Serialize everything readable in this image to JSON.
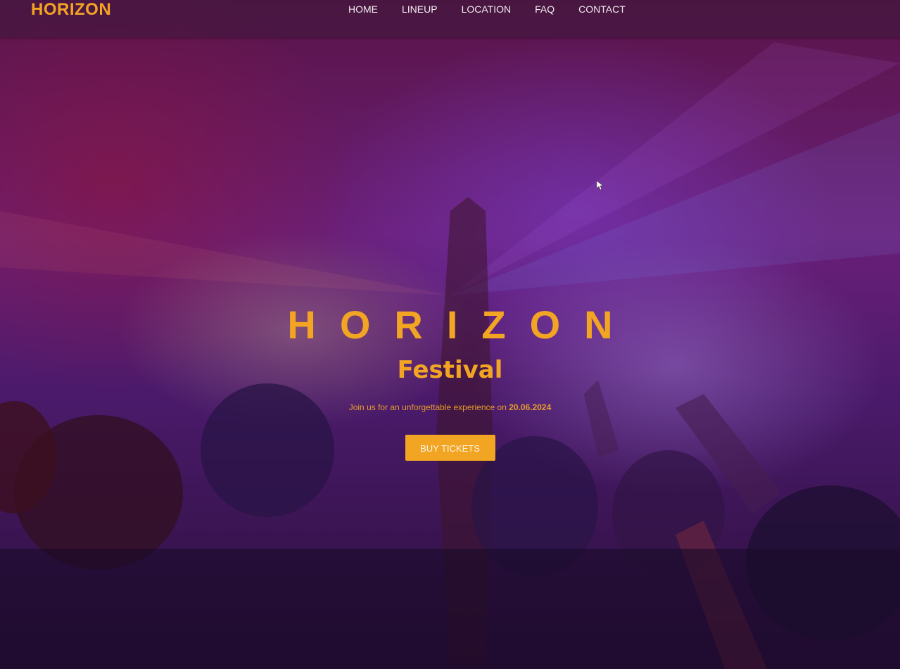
{
  "navbar": {
    "brand": "HORIZON",
    "links": [
      {
        "label": "HOME"
      },
      {
        "label": "LINEUP"
      },
      {
        "label": "LOCATION"
      },
      {
        "label": "FAQ"
      },
      {
        "label": "CONTACT"
      }
    ]
  },
  "hero": {
    "title": "HORIZON",
    "subtitle": "Festival",
    "tagline_prefix": "Join us for an unforgettable experience on",
    "date": "20.06.2024",
    "cta_label": "BUY TICKETS"
  },
  "colors": {
    "accent": "#f2a423",
    "nav_text": "#f3ecf2",
    "background": "#6a1f78"
  }
}
